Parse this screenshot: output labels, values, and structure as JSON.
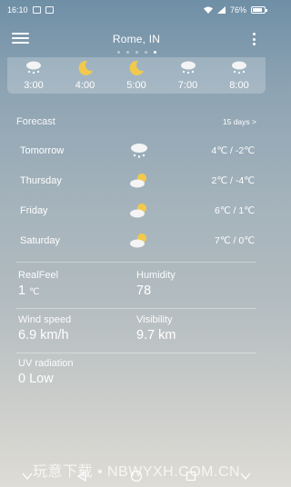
{
  "status_bar": {
    "time": "16:10",
    "battery": "76%"
  },
  "header": {
    "city": "Rome, IN"
  },
  "page_indicator": {
    "count": 5,
    "active_index": 4
  },
  "hourly": [
    {
      "time": "3:00",
      "icon": "snow-cloud-icon"
    },
    {
      "time": "4:00",
      "icon": "moon-icon"
    },
    {
      "time": "5:00",
      "icon": "moon-icon"
    },
    {
      "time": "7:00",
      "icon": "snow-cloud-icon"
    },
    {
      "time": "8:00",
      "icon": "snow-cloud-icon"
    }
  ],
  "forecast": {
    "title": "Forecast",
    "link": "15 days >",
    "days": [
      {
        "name": "Tomorrow",
        "icon": "snow-cloud-icon",
        "temp": "4℃ / -2℃"
      },
      {
        "name": "Thursday",
        "icon": "cloud-sun-icon",
        "temp": "2℃ / -4℃"
      },
      {
        "name": "Friday",
        "icon": "cloud-sun-icon",
        "temp": "6℃ / 1℃"
      },
      {
        "name": "Saturday",
        "icon": "cloud-sun-icon",
        "temp": "7℃ / 0℃"
      }
    ]
  },
  "details": {
    "realfeel_label": "RealFeel",
    "realfeel_value": "1",
    "realfeel_unit": "℃",
    "humidity_label": "Humidity",
    "humidity_value": "78",
    "wind_label": "Wind speed",
    "wind_value": "6.9 km/h",
    "visibility_label": "Visibility",
    "visibility_value": "9.7 km",
    "uv_label": "UV radiation",
    "uv_value": "0 Low"
  },
  "watermark": "玩意下载 • NBWYXH.COM.CN",
  "colors": {
    "text": "#ffffff",
    "sun": "#f2c94c",
    "cloud": "#f4f4f4"
  }
}
